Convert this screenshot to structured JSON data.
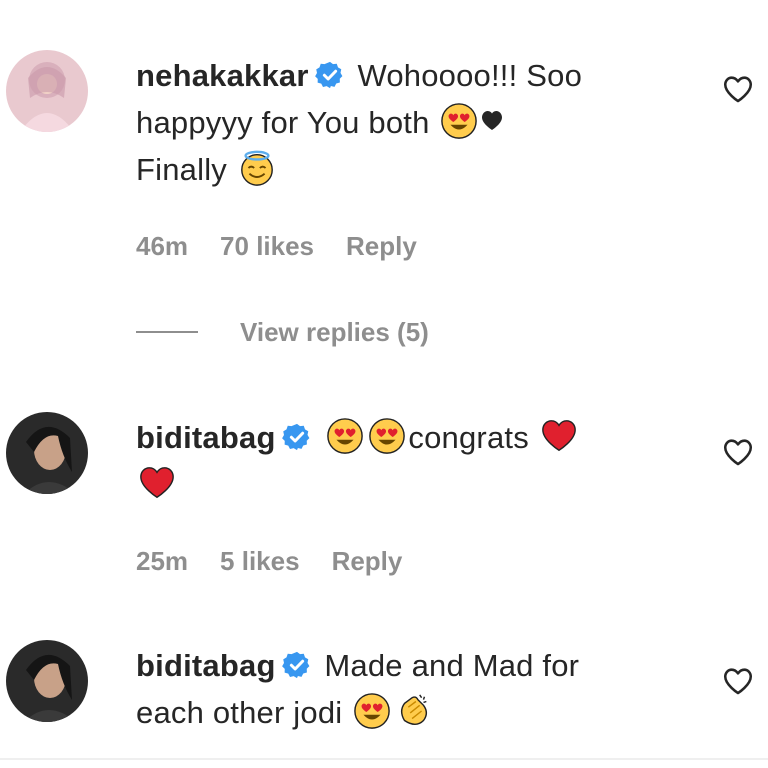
{
  "comments": [
    {
      "username": "nehakakkar",
      "text_line1": "Wohoooo!!! Soo",
      "text_line2": "happyyy for You both",
      "text_line3": "Finally",
      "time": "46m",
      "likes": "70 likes",
      "reply": "Reply",
      "view_replies": "View replies (5)"
    },
    {
      "username": "biditabag",
      "text": "congrats",
      "time": "25m",
      "likes": "5 likes",
      "reply": "Reply"
    },
    {
      "username": "biditabag",
      "text_line1": "Made and Mad for",
      "text_line2": "each other jodi"
    }
  ],
  "icons": {
    "verified": "verified-badge-icon",
    "like": "heart-outline-icon",
    "emoji_heart_eyes": "smiling-face-with-heart-eyes-emoji",
    "emoji_halo": "smiling-face-with-halo-emoji",
    "emoji_red_heart": "red-heart-emoji",
    "emoji_black_heart": "black-heart-emoji",
    "emoji_clap": "clapping-hands-emoji"
  },
  "colors": {
    "text": "#262626",
    "secondary": "#8e8e8e",
    "verified": "#3897f0"
  }
}
